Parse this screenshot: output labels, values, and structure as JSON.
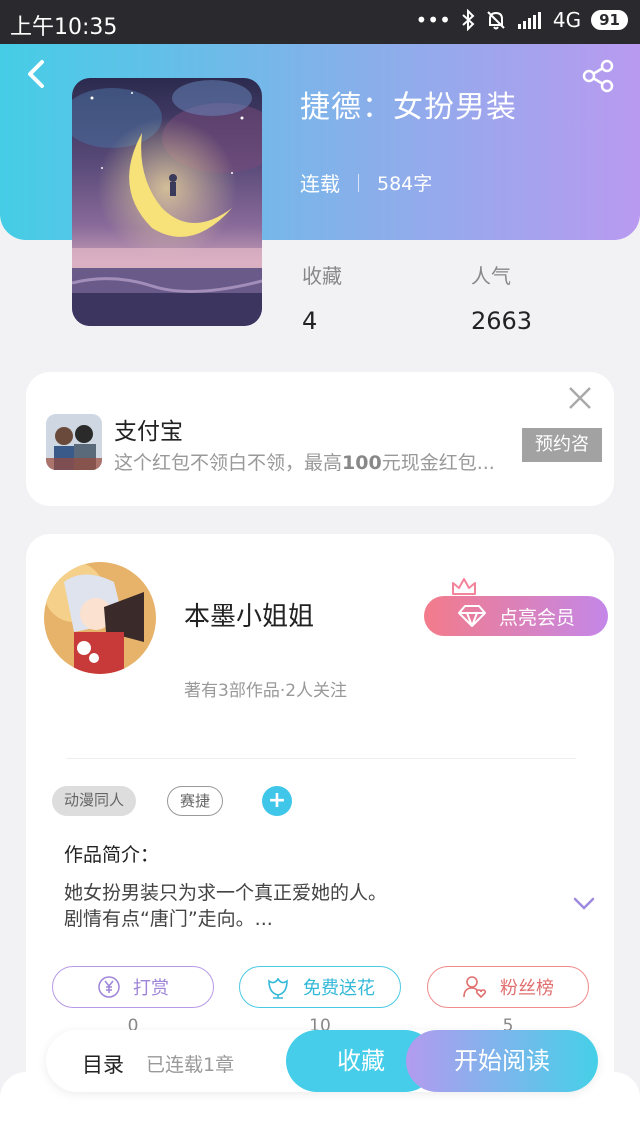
{
  "status_bar": {
    "time": "上午10:35",
    "dots": "•••",
    "network": "4G",
    "battery": "91"
  },
  "book": {
    "title": "捷德：女扮男装",
    "status": "连载",
    "word_count": "584字"
  },
  "stats": [
    {
      "label": "收藏",
      "value": "4"
    },
    {
      "label": "人气",
      "value": "2663"
    }
  ],
  "ad": {
    "app_name": "支付宝",
    "desc_prefix": "这个红包不领白不领，最高",
    "desc_bold": "100",
    "desc_suffix": "元现金红包...",
    "button": "预约咨"
  },
  "author": {
    "name": "本墨小姐姐",
    "meta": "著有3部作品·2人关注",
    "vip_button": "点亮会员"
  },
  "tags": [
    "动漫同人",
    "赛捷"
  ],
  "intro": {
    "label": "作品简介：",
    "line1": "她女扮男装只为求一个真正爱她的人。",
    "line2": "剧情有点“唐门”走向。..."
  },
  "actions": [
    {
      "label": "打赏",
      "count": "0"
    },
    {
      "label": "免费送花",
      "count": "10"
    },
    {
      "label": "粉丝榜",
      "count": "5"
    }
  ],
  "bottom": {
    "toc": "目录",
    "toc_status": "已连载1章",
    "favorite": "收藏",
    "read": "开始阅读"
  },
  "colors": {
    "accent_cyan": "#45cde6",
    "accent_purple": "#b99af0",
    "vip_pink": "#f37b8a"
  }
}
